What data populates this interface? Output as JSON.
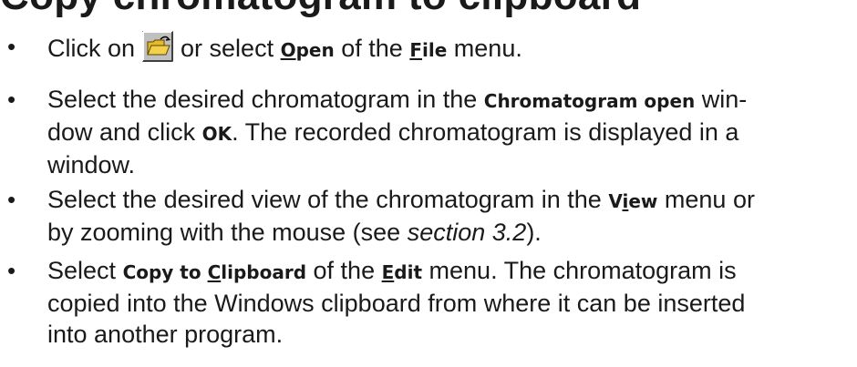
{
  "heading": "Copy chromatogram to clipboard",
  "steps": [
    {
      "bullet": "•",
      "s1_pre": "Click on",
      "s1_mid": "or select",
      "s1_open_first": "O",
      "s1_open_rest": "pen",
      "s1_of": "of the",
      "s1_file_first": "F",
      "s1_file_rest": "ile",
      "s1_end": "menu."
    },
    {
      "bullet": "•",
      "line1_pre": "Select the desired chromatogram in the",
      "line1_kw": "Chromatogram open",
      "line1_post": "win-",
      "line2_pre": "dow and click",
      "line2_kw": "OK",
      "line2_post": ". The recorded chromatogram is displayed in a",
      "line3": "window."
    },
    {
      "bullet": "•",
      "line1_pre": "Select the desired view of the chromatogram in the",
      "view_first": "V",
      "view_ul": "i",
      "view_rest": "ew",
      "line1_post": "menu or",
      "line2_pre": "by zooming with the mouse (see",
      "line2_ref": "section 3.2",
      "line2_post": ")."
    },
    {
      "bullet": "•",
      "line1_pre": "Select",
      "copy_pre": "Copy to ",
      "copy_ul": "C",
      "copy_post": "lipboard",
      "line1_mid": "of the",
      "edit_ul": "E",
      "edit_rest": "dit",
      "line1_post": "menu. The chromatogram is",
      "line2": "copied into the Windows clipboard from where it can be inserted",
      "line3": "into another program."
    }
  ],
  "icons": {
    "open_folder": "open-folder-icon"
  },
  "colors": {
    "text": "#1a1a1a",
    "button_face": "#c0c0c0",
    "folder_yellow": "#f2d04a"
  }
}
